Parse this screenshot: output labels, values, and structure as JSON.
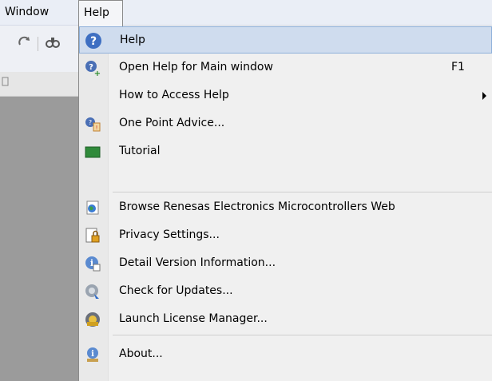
{
  "menubar": {
    "window_label": "Window",
    "help_label": "Help"
  },
  "toolbar": {
    "icons": [
      "redo-icon",
      "find-icon"
    ]
  },
  "menu": {
    "items": [
      {
        "label": "Help",
        "icon": "help-question-icon",
        "highlighted": true
      },
      {
        "label": "Open Help for Main window",
        "shortcut": "F1",
        "icon": "help-plus-icon"
      },
      {
        "label": "How to Access Help",
        "submenu": true,
        "icon": ""
      },
      {
        "label": "One Point Advice...",
        "icon": "one-point-advice-icon"
      },
      {
        "label": "Tutorial",
        "icon": "tutorial-icon"
      },
      {
        "label": "Browse Renesas Electronics Microcontrollers Web",
        "icon": "web-browser-icon"
      },
      {
        "label": "Privacy Settings...",
        "icon": "privacy-icon"
      },
      {
        "label": "Detail Version Information...",
        "icon": "version-info-icon"
      },
      {
        "label": "Check for Updates...",
        "icon": "check-updates-icon"
      },
      {
        "label": "Launch License Manager...",
        "icon": "license-manager-icon"
      },
      {
        "label": "About...",
        "icon": "about-icon"
      }
    ]
  },
  "colors": {
    "menu_bg": "#f0f0f0",
    "highlight": "#cfdcee",
    "highlight_border": "#8fb0da",
    "workspace": "#9b9b9b"
  }
}
